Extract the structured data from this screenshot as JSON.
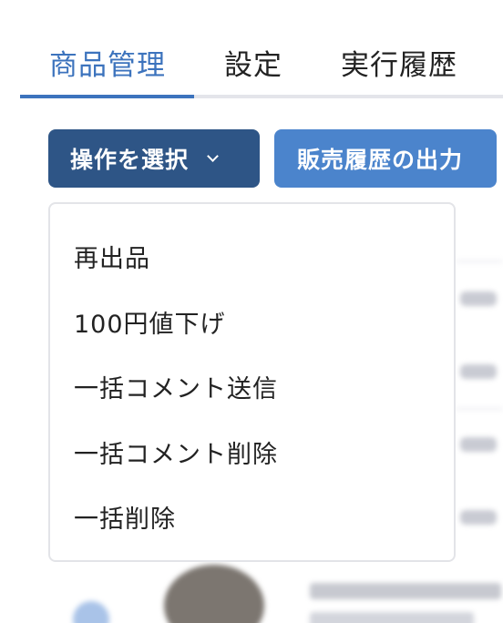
{
  "tabs": [
    {
      "label": "商品管理",
      "active": true
    },
    {
      "label": "設定",
      "active": false
    },
    {
      "label": "実行履歴",
      "active": false
    }
  ],
  "toolbar": {
    "action_label": "操作を選択",
    "export_label": "販売履歴の出力"
  },
  "menu": {
    "items": [
      {
        "label": "再出品"
      },
      {
        "label": "100円値下げ"
      },
      {
        "label": "一括コメント送信"
      },
      {
        "label": "一括コメント削除"
      },
      {
        "label": "一括削除"
      }
    ]
  },
  "colors": {
    "accent": "#3c73bd",
    "primary_button": "#2e5586",
    "secondary_button": "#4b84cc"
  }
}
